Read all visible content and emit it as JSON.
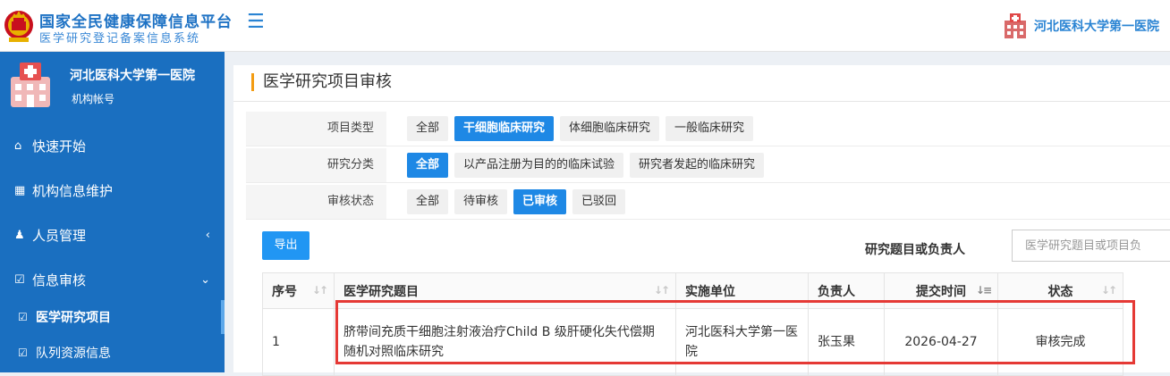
{
  "header": {
    "title": "国家全民健康保障信息平台",
    "subtitle": "医学研究登记备案信息系统",
    "menu_icon": "hamburger-icon",
    "org_name": "河北医科大学第一医院"
  },
  "sidebar": {
    "org_name": "河北医科大学第一医院",
    "account_type": "机构帐号",
    "items": [
      {
        "icon": "home-icon",
        "label": "快速开始"
      },
      {
        "icon": "building-icon",
        "label": "机构信息维护"
      },
      {
        "icon": "users-icon",
        "label": "人员管理"
      },
      {
        "icon": "checkbox-icon",
        "label": "信息审核"
      }
    ],
    "subitems": [
      {
        "icon": "checkbox-icon",
        "label": "医学研究项目"
      },
      {
        "icon": "checkbox-icon",
        "label": "队列资源信息"
      }
    ]
  },
  "page": {
    "title": "医学研究项目审核",
    "filters": [
      {
        "label": "项目类型",
        "options": [
          "全部",
          "干细胞临床研究",
          "体细胞临床研究",
          "一般临床研究"
        ],
        "selected": 1
      },
      {
        "label": "研究分类",
        "options": [
          "全部",
          "以产品注册为目的的临床试验",
          "研究者发起的临床研究"
        ],
        "selected": 0
      },
      {
        "label": "审核状态",
        "options": [
          "全部",
          "待审核",
          "已审核",
          "已驳回"
        ],
        "selected": 2
      }
    ],
    "export_label": "导出",
    "search": {
      "label": "研究题目或负责人",
      "placeholder": "医学研究题目或项目负"
    },
    "table": {
      "columns": [
        "序号",
        "医学研究题目",
        "实施单位",
        "负责人",
        "提交时间",
        "状态"
      ],
      "rows": [
        {
          "index": "1",
          "title": "脐带间充质干细胞注射液治疗Child B 级肝硬化失代偿期随机对照临床研究",
          "unit": "河北医科大学第一医院",
          "lead": "张玉果",
          "submitted": "2026-04-27",
          "status": "审核完成"
        }
      ]
    }
  }
}
